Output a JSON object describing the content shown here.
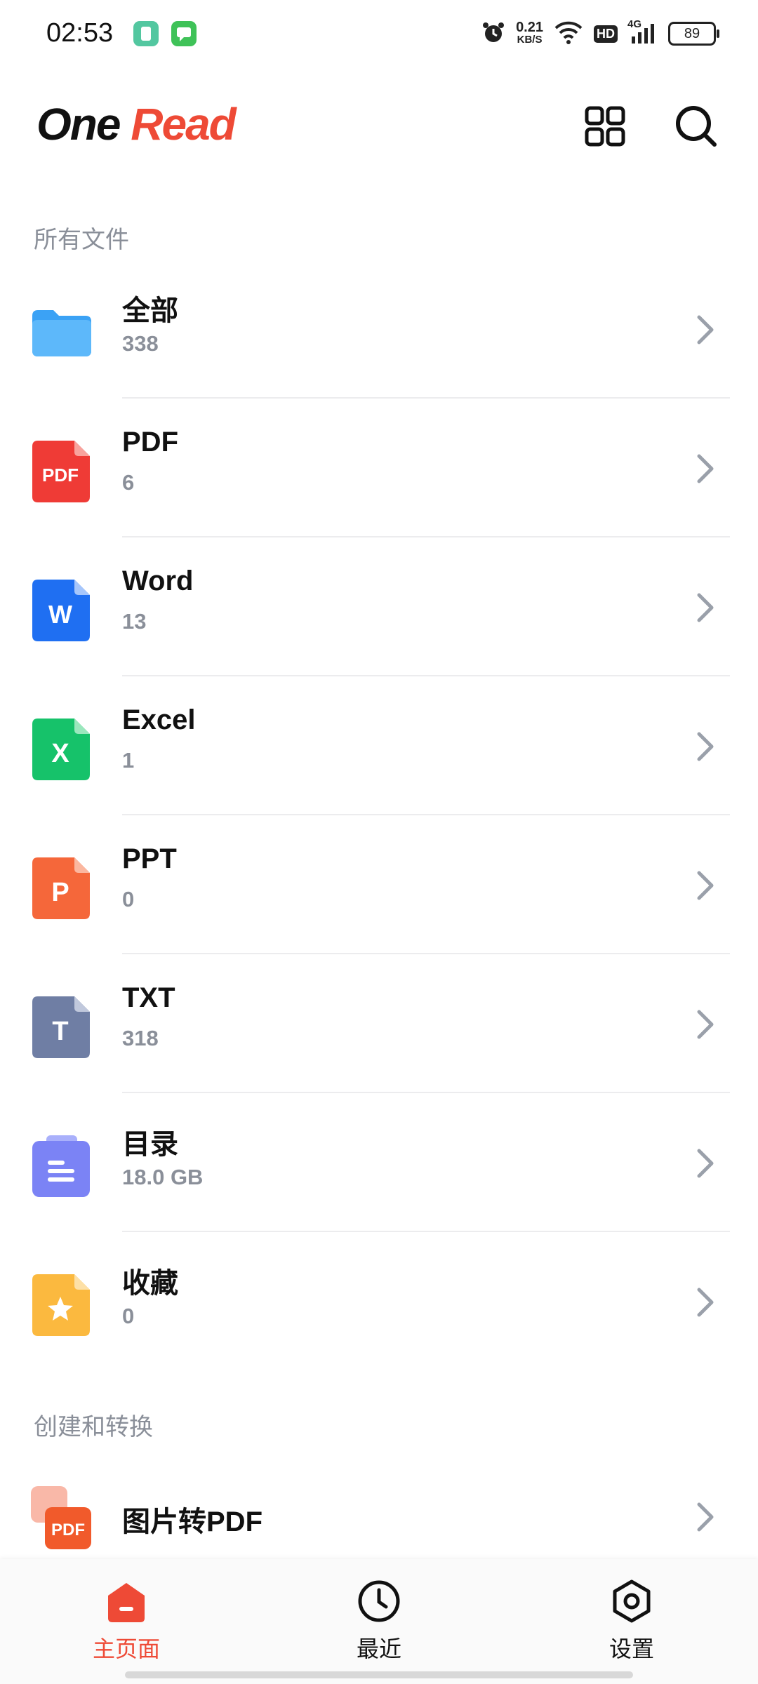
{
  "status_bar": {
    "time": "02:53",
    "speed_value": "0.21",
    "speed_unit": "KB/S",
    "hd_badge": "HD",
    "network": "4G",
    "battery": "89"
  },
  "header": {
    "logo_part1": "One",
    "logo_part2": "Read",
    "grid_icon": "grid-icon",
    "search_icon": "search-icon"
  },
  "sections": {
    "all_files_title": "所有文件",
    "create_convert_title": "创建和转换"
  },
  "files": [
    {
      "name": "全部",
      "count": "338",
      "icon": "folder-icon"
    },
    {
      "name": "PDF",
      "count": "6",
      "icon": "pdf-file-icon"
    },
    {
      "name": "Word",
      "count": "13",
      "icon": "word-file-icon"
    },
    {
      "name": "Excel",
      "count": "1",
      "icon": "excel-file-icon"
    },
    {
      "name": "PPT",
      "count": "0",
      "icon": "ppt-file-icon"
    },
    {
      "name": "TXT",
      "count": "318",
      "icon": "txt-file-icon"
    },
    {
      "name": "目录",
      "count": "18.0 GB",
      "icon": "directory-icon"
    },
    {
      "name": "收藏",
      "count": "0",
      "icon": "favorites-icon"
    }
  ],
  "icon_letters": {
    "pdf": "PDF",
    "word": "W",
    "excel": "X",
    "ppt": "P",
    "txt": "T"
  },
  "convert": {
    "image_to_pdf": "图片转PDF",
    "icon_badge": "PDF"
  },
  "nav": {
    "home": "主页面",
    "recent": "最近",
    "settings": "设置"
  },
  "colors": {
    "accent": "#ee4a36",
    "folder": "#3ba2f5",
    "pdf": "#ef3b36",
    "word": "#1f6ff2",
    "excel": "#16c26a",
    "ppt": "#f5673a",
    "txt": "#6f7ea4",
    "directory": "#7b83f5",
    "favorites": "#fbb93f"
  }
}
